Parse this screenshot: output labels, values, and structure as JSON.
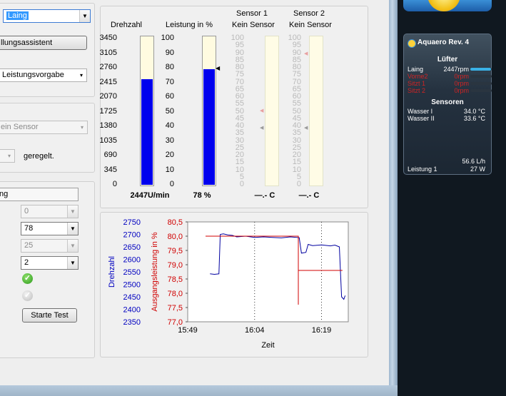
{
  "left_panel": {
    "pump_select": "Laing",
    "wizard_button": "llungsassistent",
    "mode_select": "Leistungsvorgabe",
    "sensor_select": "ein Sensor",
    "small_select": "",
    "regulated_label": "geregelt.",
    "test_label": "ng",
    "spin1": "0",
    "spin2": "78",
    "spin3": "25",
    "spin4": "2",
    "start_test_button": "Starte Test"
  },
  "gauges": [
    {
      "header": "Drehzahl",
      "ticks": [
        "3450",
        "3105",
        "2760",
        "2415",
        "2070",
        "1725",
        "1380",
        "1035",
        "690",
        "345",
        "0"
      ],
      "fill_fraction": 0.71,
      "readout": "2447U/min",
      "dim": false
    },
    {
      "header": "Leistung in %",
      "ticks": [
        "100",
        "90",
        "80",
        "70",
        "60",
        "50",
        "40",
        "30",
        "20",
        "10",
        "0"
      ],
      "fill_fraction": 0.78,
      "readout": "78 %",
      "dim": false
    },
    {
      "header_line1": "Sensor 1",
      "header": "Kein Sensor",
      "ticks": [
        "100",
        "95",
        "90",
        "85",
        "80",
        "75",
        "70",
        "65",
        "60",
        "55",
        "50",
        "45",
        "40",
        "35",
        "30",
        "25",
        "20",
        "15",
        "10",
        "5",
        "0"
      ],
      "fill_fraction": 0,
      "readout": "—.- C",
      "dim": true
    },
    {
      "header_line1": "Sensor 2",
      "header": "Kein Sensor",
      "ticks": [
        "100",
        "95",
        "90",
        "85",
        "80",
        "75",
        "70",
        "65",
        "60",
        "55",
        "50",
        "45",
        "40",
        "35",
        "30",
        "25",
        "20",
        "15",
        "10",
        "5",
        "0"
      ],
      "fill_fraction": 0,
      "readout": "—.- C",
      "dim": true
    }
  ],
  "chart_data": {
    "type": "line",
    "xlabel": "Zeit",
    "ylabel_left": "Drehzahl",
    "ylabel_right": "Ausgangsleistung in %",
    "x_ticks": [
      "15:49",
      "16:04",
      "16:19"
    ],
    "y1_ticks": [
      "2750",
      "2700",
      "2650",
      "2600",
      "2550",
      "2500",
      "2450",
      "2400",
      "2350"
    ],
    "y2_ticks": [
      "80,5",
      "80,0",
      "79,5",
      "79,0",
      "78,5",
      "78,0",
      "77,5",
      "77,0"
    ],
    "y1_lim": [
      2350,
      2750
    ],
    "y2_lim": [
      77.0,
      80.5
    ],
    "x_lim_minutes": [
      0,
      36
    ],
    "series": [
      {
        "axis": "left",
        "color": "#0000a0",
        "points": [
          [
            5,
            2542
          ],
          [
            6,
            2540
          ],
          [
            7,
            2542
          ],
          [
            7.3,
            2700
          ],
          [
            8,
            2702
          ],
          [
            9,
            2698
          ],
          [
            10,
            2696
          ],
          [
            11,
            2690
          ],
          [
            13,
            2693
          ],
          [
            15,
            2688
          ],
          [
            17,
            2690
          ],
          [
            19,
            2688
          ],
          [
            21,
            2686
          ],
          [
            23,
            2690
          ],
          [
            25,
            2687
          ],
          [
            25.5,
            2625
          ],
          [
            26.5,
            2628
          ],
          [
            27,
            2660
          ],
          [
            28,
            2655
          ],
          [
            30,
            2658
          ],
          [
            32,
            2654
          ],
          [
            33,
            2657
          ],
          [
            34,
            2650
          ],
          [
            34.5,
            2450
          ],
          [
            35,
            2440
          ],
          [
            35.3,
            2455
          ]
        ]
      },
      {
        "axis": "right",
        "color": "#d00000",
        "points": [
          [
            4,
            80.0
          ],
          [
            24.8,
            80.0
          ],
          [
            24.8,
            77.6
          ],
          [
            24.8,
            78.8
          ],
          [
            34.7,
            78.8
          ]
        ]
      }
    ],
    "colors": {
      "left_axis": "#0000c0",
      "right_axis": "#d00000"
    }
  },
  "aquaero": {
    "title": "Aquaero Rev. 4",
    "fans_header": "Lüfter",
    "fans": [
      {
        "name": "Laing",
        "value": "2447rpm",
        "level": 0.95,
        "warn": false
      },
      {
        "name": "Vorne2",
        "value": "0rpm",
        "level": 0,
        "warn": true
      },
      {
        "name": "Sitzt 1",
        "value": "0rpm",
        "level": 0,
        "warn": true
      },
      {
        "name": "Sitzt 2",
        "value": "0rpm",
        "level": 0,
        "warn": true
      }
    ],
    "sensors_header": "Sensoren",
    "sensors": [
      {
        "name": "Wasser I",
        "value": "34.0 °C"
      },
      {
        "name": "Wasser II",
        "value": "33.6 °C"
      }
    ],
    "flow": "56.6 L/h",
    "power_label": "Leistung 1",
    "power_value": "27 W"
  },
  "colors": {
    "fill": "#0000ee",
    "tube": "#fffbe0",
    "accent": "#3ab1e6"
  }
}
